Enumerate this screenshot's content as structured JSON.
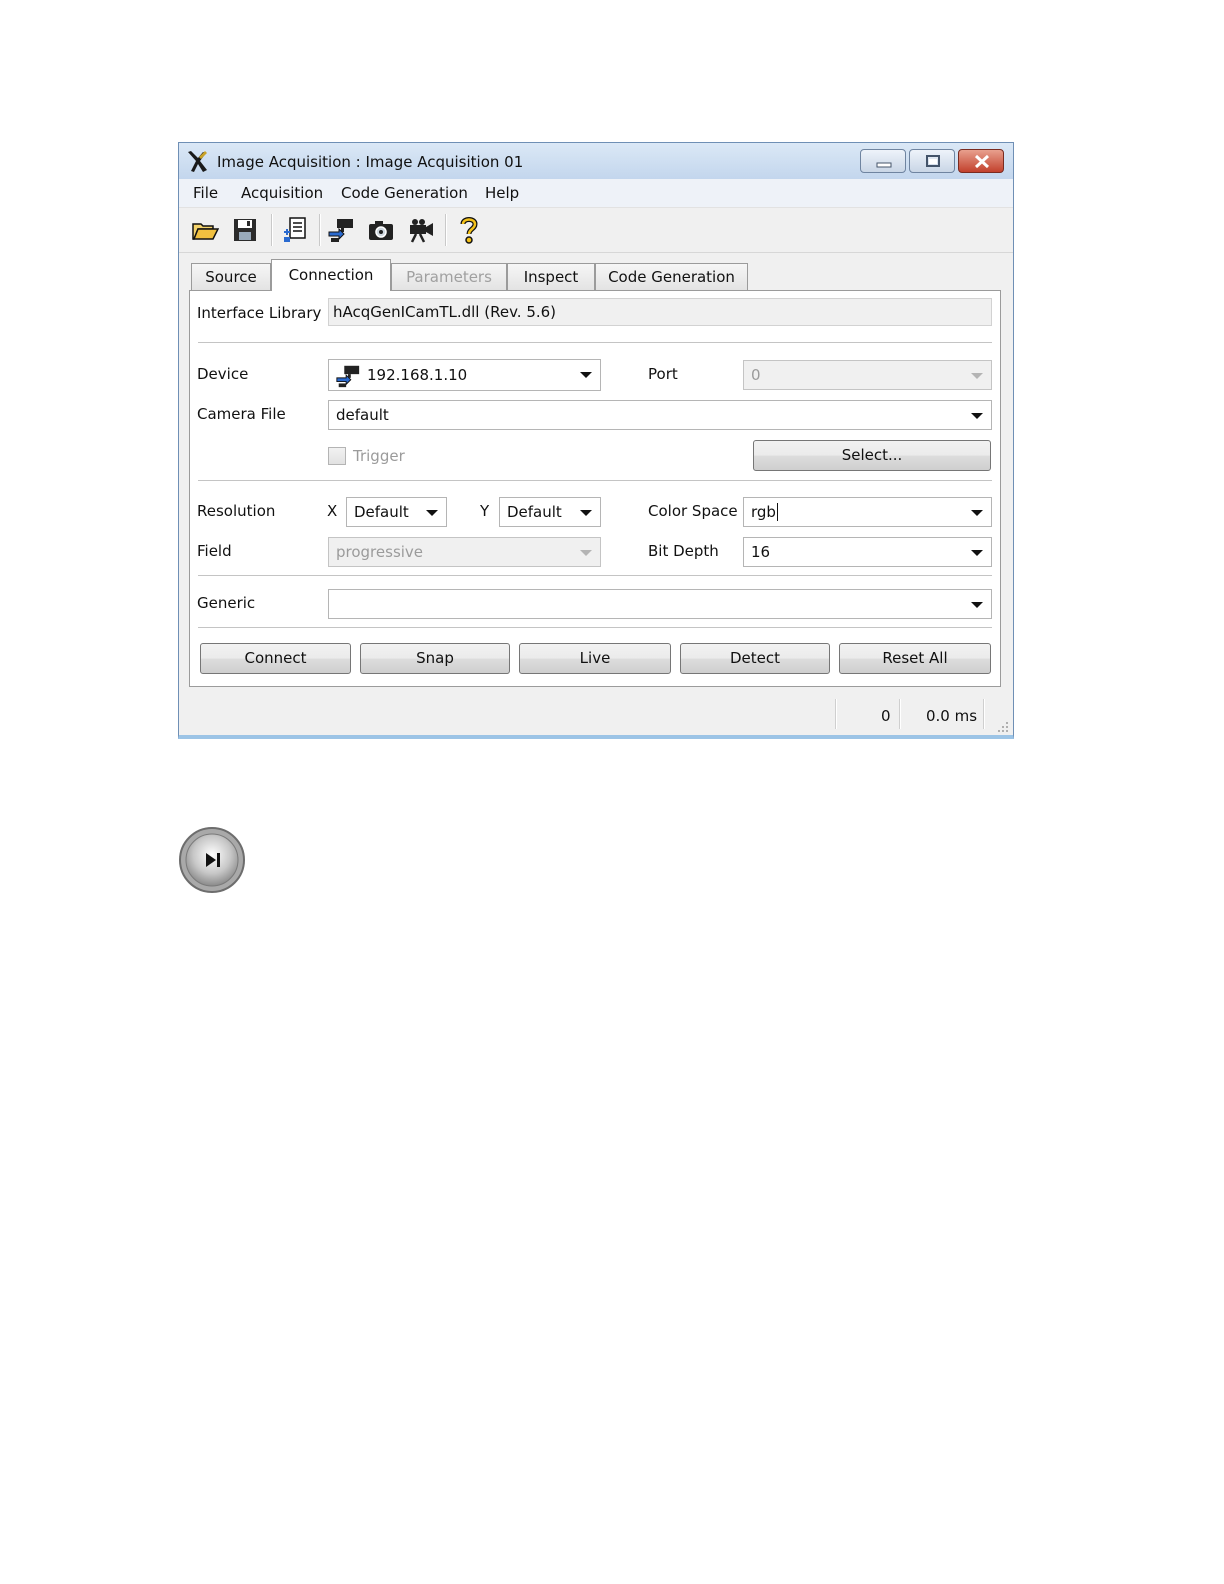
{
  "window": {
    "title": "Image Acquisition : Image Acquisition 01",
    "controls": [
      "minimize-icon",
      "maximize-icon",
      "close-icon"
    ]
  },
  "menu": {
    "file": "File",
    "acquisition": "Acquisition",
    "code_generation": "Code Generation",
    "help": "Help"
  },
  "toolbar": {
    "icons": [
      "open-folder-icon",
      "save-icon",
      "settings-list-icon",
      "connect-icon",
      "snap-camera-icon",
      "live-video-icon",
      "help-icon"
    ]
  },
  "tabs": {
    "source": "Source",
    "connection": "Connection",
    "parameters": "Parameters",
    "inspect": "Inspect",
    "code_generation": "Code Generation",
    "active": "Connection"
  },
  "connection": {
    "interface_library_label": "Interface Library",
    "interface_library_value": "hAcqGenICamTL.dll (Rev. 5.6)",
    "device_label": "Device",
    "device_value": "192.168.1.10",
    "port_label": "Port",
    "port_value": "0",
    "camera_file_label": "Camera File",
    "camera_file_value": "default",
    "trigger_label": "Trigger",
    "trigger_checked": false,
    "select_button": "Select...",
    "resolution_label": "Resolution",
    "x_label": "X",
    "x_value": "Default",
    "y_label": "Y",
    "y_value": "Default",
    "color_space_label": "Color Space",
    "color_space_value": "rgb",
    "field_label": "Field",
    "field_value": "progressive",
    "bit_depth_label": "Bit Depth",
    "bit_depth_value": "16",
    "generic_label": "Generic",
    "generic_value": ""
  },
  "actions": {
    "connect": "Connect",
    "snap": "Snap",
    "live": "Live",
    "detect": "Detect",
    "reset_all": "Reset All"
  },
  "status": {
    "count": "0",
    "time": "0.0 ms"
  },
  "colors": {
    "titlebar": "#c3d6ed",
    "window_bg": "#f0f0f0",
    "close_button": "#c2412d"
  }
}
